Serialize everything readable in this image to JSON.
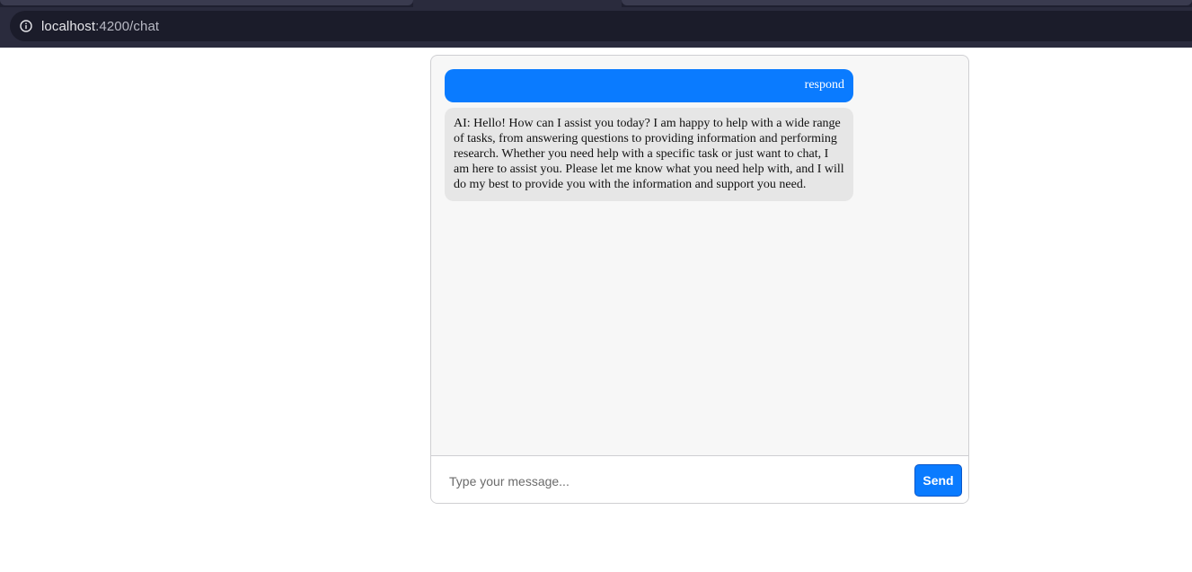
{
  "browser": {
    "url_host": "localhost",
    "url_path": ":4200/chat",
    "info_icon": "info-circle-icon"
  },
  "chat": {
    "messages": [
      {
        "role": "user",
        "text": "respond"
      },
      {
        "role": "ai",
        "text": "AI: Hello! How can I assist you today? I am happy to help with a wide range of tasks, from answering questions to providing information and performing research. Whether you need help with a specific task or just want to chat, I am here to assist you. Please let me know what you need help with, and I will do my best to provide you with the information and support you need."
      }
    ],
    "input": {
      "placeholder": "Type your message...",
      "value": ""
    },
    "send_label": "Send"
  },
  "colors": {
    "user_bubble": "#0a7bff",
    "ai_bubble": "#e6e6e6",
    "send_button": "#0a7bff"
  }
}
